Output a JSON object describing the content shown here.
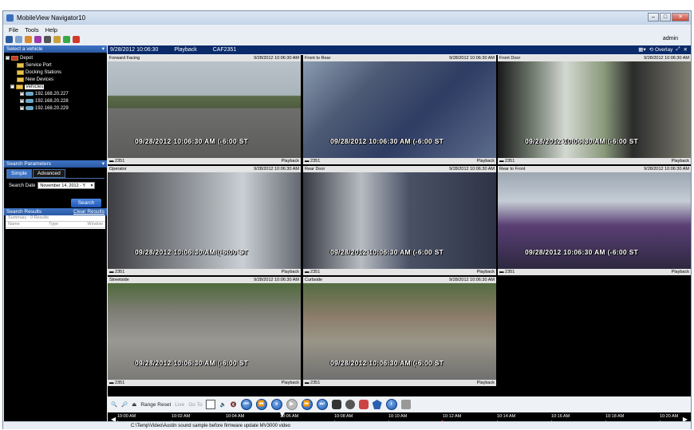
{
  "window": {
    "title": "MobileView Navigator10"
  },
  "menu": {
    "file": "File",
    "tools": "Tools",
    "help": "Help"
  },
  "user": "admin",
  "vehicle_panel": {
    "header": "Select a vehicle",
    "tree": {
      "root": "Depot",
      "items": [
        "Service Port",
        "Docking Stations",
        "New Devices",
        "Vehicles"
      ],
      "vehicles": [
        "192.168.20.227",
        "192.168.20.228",
        "192.168.20.229"
      ]
    }
  },
  "search_panel": {
    "header": "Search Parameters",
    "tabs": [
      "Simple",
      "Advanced"
    ],
    "date_label": "Search Date",
    "date_value": "November 14, 2012 - Y",
    "search_button": "Search",
    "results_header": "Search Results",
    "clear_results": "Clear Results",
    "summary": "Summary : 0 Results",
    "columns": [
      "Name",
      "Type",
      "Window"
    ]
  },
  "video_header": {
    "datetime": "9/28/2012 10:06:30",
    "mode": "Playback",
    "vehicle": "CAF2351",
    "overlay": "Overlay"
  },
  "cameras": [
    {
      "name": "Forward Facing",
      "time": "9/28/2012 10:06:30 AM",
      "overlay": "09/28/2012 10:06:30 AM (-6:00 ST",
      "unit": "2351",
      "status": "Playback",
      "scene": "road"
    },
    {
      "name": "Front to Rear",
      "time": "9/28/2012 10:06:30 AM",
      "overlay": "09/28/2012 10:06:30 AM (-6:00 ST",
      "unit": "2351",
      "status": "Playback",
      "scene": "interior"
    },
    {
      "name": "Front Door",
      "time": "9/28/2012 10:06:30 AM",
      "overlay": "09/28/2012 10:06:30 AM (-6:00 ST",
      "unit": "2351",
      "status": "Playback",
      "scene": "door"
    },
    {
      "name": "Operator",
      "time": "9/28/2012 10:06:30 AM",
      "overlay": "09/28/2012 10:06:30 AM (-6:00 ST",
      "unit": "2351",
      "status": "Playback",
      "scene": "operator"
    },
    {
      "name": "Rear Door",
      "time": "9/28/2012 10:06:30 AM",
      "overlay": "09/28/2012 10:06:30 AM (-6:00 ST",
      "unit": "2351",
      "status": "Playback",
      "scene": "reardoor"
    },
    {
      "name": "Rear to Front",
      "time": "9/28/2012 10:06:30 AM",
      "overlay": "09/28/2012 10:06:30 AM (-6:00 ST",
      "unit": "2351",
      "status": "Playback",
      "scene": "seats"
    },
    {
      "name": "Streetside",
      "time": "9/28/2012 10:06:30 AM",
      "overlay": "09/28/2012 10:06:30 AM (-6:00 ST",
      "unit": "2351",
      "status": "Playback",
      "scene": "street"
    },
    {
      "name": "Curbside",
      "time": "9/28/2012 10:06:30 AM",
      "overlay": "09/28/2012 10:06:30 AM (-6:00 ST",
      "unit": "2351",
      "status": "Playback",
      "scene": "curb"
    }
  ],
  "controls": {
    "range_reset": "Range Reset",
    "live": "Live",
    "goto": "Go To"
  },
  "timeline": {
    "ticks": [
      "10:00 AM",
      "10:02 AM",
      "10:04 AM",
      "10:06 AM",
      "10:08 AM",
      "10:10 AM",
      "10:12 AM",
      "10:14 AM",
      "10:16 AM",
      "10:18 AM",
      "10:20 AM"
    ]
  },
  "status_path": "C:\\Temp\\Video\\Austin sound sample before firmware update MV3000 video"
}
